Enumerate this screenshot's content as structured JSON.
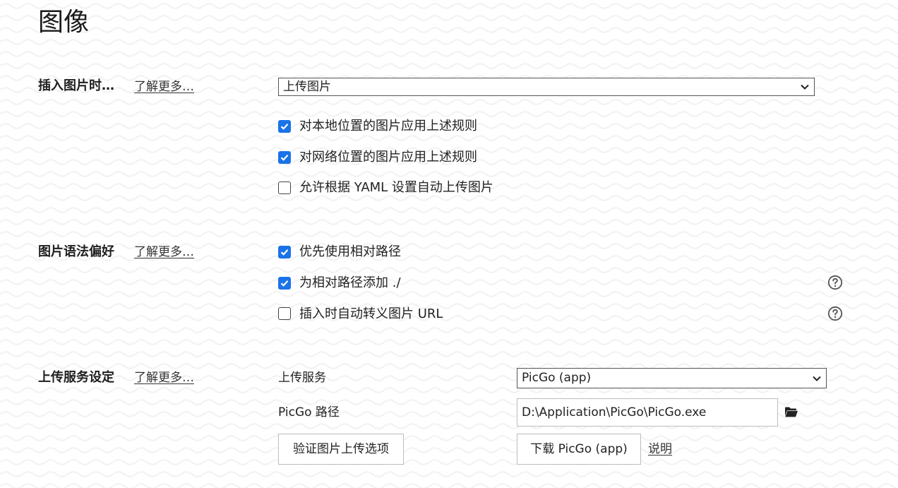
{
  "page": {
    "title": "图像"
  },
  "colors": {
    "accent": "#1a73e8",
    "text": "#222222",
    "border": "#bdbdbd"
  },
  "sections": {
    "insert_image": {
      "title": "插入图片时…",
      "learn_more": "了解更多…",
      "action_select": {
        "value": "上传图片"
      },
      "options": [
        {
          "label": "对本地位置的图片应用上述规则",
          "checked": true
        },
        {
          "label": "对网络位置的图片应用上述规则",
          "checked": true
        },
        {
          "label": "允许根据 YAML 设置自动上传图片",
          "checked": false
        }
      ]
    },
    "image_syntax": {
      "title": "图片语法偏好",
      "learn_more": "了解更多…",
      "options": [
        {
          "label": "优先使用相对路径",
          "checked": true,
          "help": false
        },
        {
          "label": "为相对路径添加 ./",
          "checked": true,
          "help": true
        },
        {
          "label": "插入时自动转义图片 URL",
          "checked": false,
          "help": true
        }
      ]
    },
    "upload_service": {
      "title": "上传服务设定",
      "learn_more": "了解更多…",
      "service_label": "上传服务",
      "service_select": {
        "value": "PicGo (app)"
      },
      "path_label": "PicGo 路径",
      "path_value": "D:\\Application\\PicGo\\PicGo.exe",
      "verify_button": "验证图片上传选项",
      "download_button": "下载 PicGo (app)",
      "explain_link": "说明"
    }
  },
  "icons": {
    "chevron": "chevron-down-icon",
    "help": "help-circle-icon",
    "folder": "folder-icon",
    "check": "checkmark-icon"
  }
}
